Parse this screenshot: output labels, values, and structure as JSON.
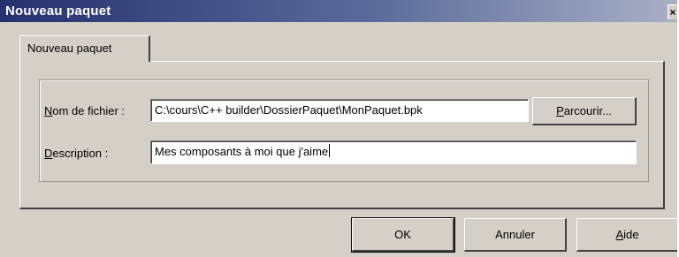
{
  "window": {
    "title": "Nouveau paquet",
    "close_glyph": "×"
  },
  "tabs": [
    {
      "label": "Nouveau paquet",
      "active": true
    }
  ],
  "form": {
    "filename": {
      "label_mnemonic": "N",
      "label_rest": "om de fichier :",
      "value": "C:\\cours\\C++ builder\\DossierPaquet\\MonPaquet.bpk"
    },
    "description": {
      "label_mnemonic": "D",
      "label_rest": "escription :",
      "value": "Mes composants à moi que j'aime"
    },
    "browse_button": {
      "label_mnemonic": "P",
      "label_rest": "arcourir..."
    }
  },
  "footer": {
    "ok_label": "OK",
    "cancel_label": "Annuler",
    "help_label_mnemonic": "A",
    "help_label_rest": "ide"
  },
  "colors": {
    "face": "#d4d0c8",
    "title_start": "#26306e",
    "title_end": "#a9b0c6"
  }
}
